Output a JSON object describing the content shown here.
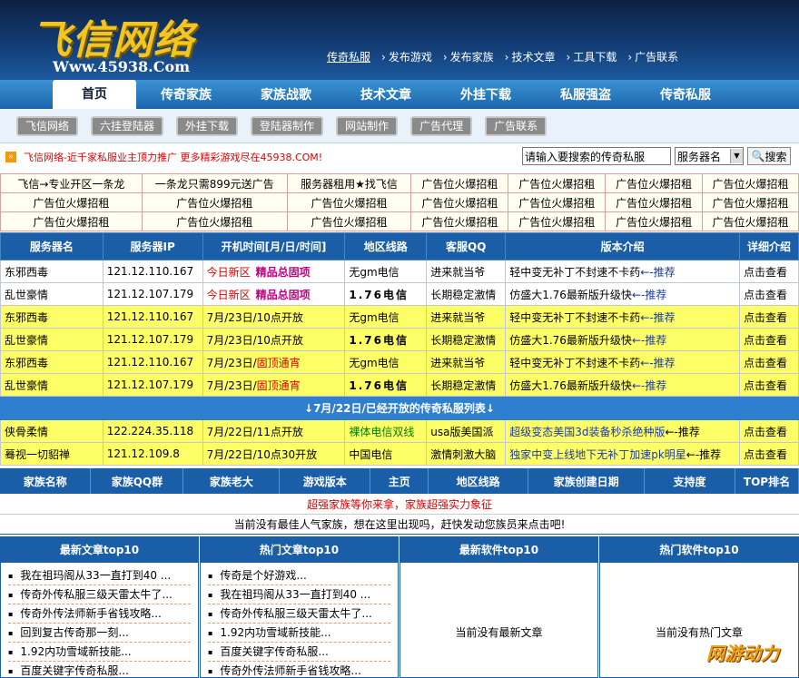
{
  "header": {
    "logo": "飞信网络",
    "url": "Www.45938.Com",
    "links": [
      "传奇私服",
      "发布游戏",
      "发布家族",
      "技术文章",
      "工具下载",
      "广告联系"
    ]
  },
  "nav": {
    "tabs": [
      "首页",
      "传奇家族",
      "家族战歌",
      "技术文章",
      "外挂下载",
      "私服强盗",
      "传奇私服"
    ]
  },
  "subnav": {
    "buttons": [
      "飞信网络",
      "六挂登陆器",
      "外挂下载",
      "登陆器制作",
      "网站制作",
      "广告代理",
      "广告联系"
    ]
  },
  "notice": {
    "text": "飞信网络-近千家私服业主顶力推广 更多精彩游戏尽在45938.COM!"
  },
  "search": {
    "placeholder": "请输入要搜索的传奇私服",
    "select": "服务器名",
    "button": "搜索"
  },
  "ads": [
    [
      "飞信→专业开区一条龙",
      "一条龙只需899元送广告",
      "服务器租用★找飞信",
      "广告位火爆招租",
      "广告位火爆招租",
      "广告位火爆招租",
      "广告位火爆招租"
    ],
    [
      "广告位火爆招租",
      "广告位火爆招租",
      "广告位火爆招租",
      "广告位火爆招租",
      "广告位火爆招租",
      "广告位火爆招租",
      "广告位火爆招租"
    ],
    [
      "广告位火爆招租",
      "广告位火爆招租",
      "广告位火爆招租",
      "广告位火爆招租",
      "广告位火爆招租",
      "广告位火爆招租",
      "广告位火爆招租"
    ]
  ],
  "servers": {
    "headers": [
      "服务器名",
      "服务器IP",
      "开机时间[月/日/时间]",
      "地区线路",
      "客服QQ",
      "版本介绍",
      "详细介绍"
    ],
    "rows": [
      {
        "name": "东邪西毒",
        "ip": "121.12.110.167",
        "time_a": "今日新区",
        "time_b": "精品总固项",
        "line": "无gm电信",
        "qq": "进来就当爷",
        "intro": "轻中变无补丁不封速不卡药",
        "tag": "←-推荐",
        "detail": "点击查看",
        "style": "white"
      },
      {
        "name": "乱世豪情",
        "ip": "121.12.107.179",
        "time_a": "今日新区",
        "time_b": "精品总固项",
        "line": "1.76电信",
        "qq": "长期稳定激情",
        "intro": "仿盛大1.76最新版升级快",
        "tag": "←-推荐",
        "detail": "点击查看",
        "style": "white"
      },
      {
        "name": "东邪西毒",
        "ip": "121.12.110.167",
        "time_a": "7月/23日/10点开放",
        "time_b": "",
        "line": "无gm电信",
        "qq": "进来就当爷",
        "intro": "轻中变无补丁不封速不卡药",
        "tag": "←-推荐",
        "detail": "点击查看",
        "style": "yellow"
      },
      {
        "name": "乱世豪情",
        "ip": "121.12.107.179",
        "time_a": "7月/23日/10点开放",
        "time_b": "",
        "line": "1.76电信",
        "qq": "长期稳定激情",
        "intro": "仿盛大1.76最新版升级快",
        "tag": "←-推荐",
        "detail": "点击查看",
        "style": "yellow"
      },
      {
        "name": "东邪西毒",
        "ip": "121.12.110.167",
        "time_a": "7月/23日/",
        "time_b": "固顶通宵",
        "line": "无gm电信",
        "qq": "进来就当爷",
        "intro": "轻中变无补丁不封速不卡药",
        "tag": "←-推荐",
        "detail": "点击查看",
        "style": "yellow"
      },
      {
        "name": "乱世豪情",
        "ip": "121.12.107.179",
        "time_a": "7月/23日/",
        "time_b": "固顶通宵",
        "line": "1.76电信",
        "qq": "长期稳定激情",
        "intro": "仿盛大1.76最新版升级快",
        "tag": "←-推荐",
        "detail": "点击查看",
        "style": "yellow"
      }
    ],
    "divider": "↓7月/22日/已经开放的传奇私服列表↓",
    "rows2": [
      {
        "name": "侠骨柔情",
        "ip": "122.224.35.118",
        "time": "7月/22日/11点开放",
        "line": "裸体电信双线",
        "qq": "usa版美国派",
        "intro": "超级变态美国3d装备秒杀绝种版",
        "tag": "←-推荐",
        "detail": "点击查看"
      },
      {
        "name": "蓦视一切貂禅",
        "ip": "121.12.109.8",
        "time": "7月/22日/10点30开放",
        "line": "中国电信",
        "qq": "激情刺激大脑",
        "intro": "独家中变上线地下无补丁加速pk明星",
        "tag": "←-推荐",
        "detail": "点击查看"
      }
    ]
  },
  "family": {
    "headers": [
      "家族名称",
      "家族QQ群",
      "家族老大",
      "游戏版本",
      "主页",
      "地区线路",
      "家族创建日期",
      "支持度",
      "TOP排名"
    ],
    "slogan": "超强家族等你来拿，家族超强实力象征",
    "none": "当前没有最佳人气家族，想在这里出现吗，赶快发动您族员来点击吧!"
  },
  "columns": [
    {
      "title": "最新文章top10",
      "items": [
        "我在祖玛阁从33一直打到40 ...",
        "传奇外传私服三级天雷太牛了...",
        "传奇外传法师新手省钱攻略...",
        "回到复古传奇那一刻...",
        "1.92内功雪域新技能...",
        "百度关键字传奇私服..."
      ]
    },
    {
      "title": "热门文章top10",
      "items": [
        "传奇是个好游戏...",
        "我在祖玛阁从33一直打到40 ...",
        "传奇外传私服三级天雷太牛了...",
        "1.92内功雪域新技能...",
        "百度关键字传奇私服...",
        "传奇外传法师新手省钱攻略..."
      ]
    },
    {
      "title": "最新软件top10",
      "empty": "当前没有最新文章"
    },
    {
      "title": "热门软件top10",
      "empty": "当前没有热门文章"
    }
  ],
  "watermark": "网游动力"
}
